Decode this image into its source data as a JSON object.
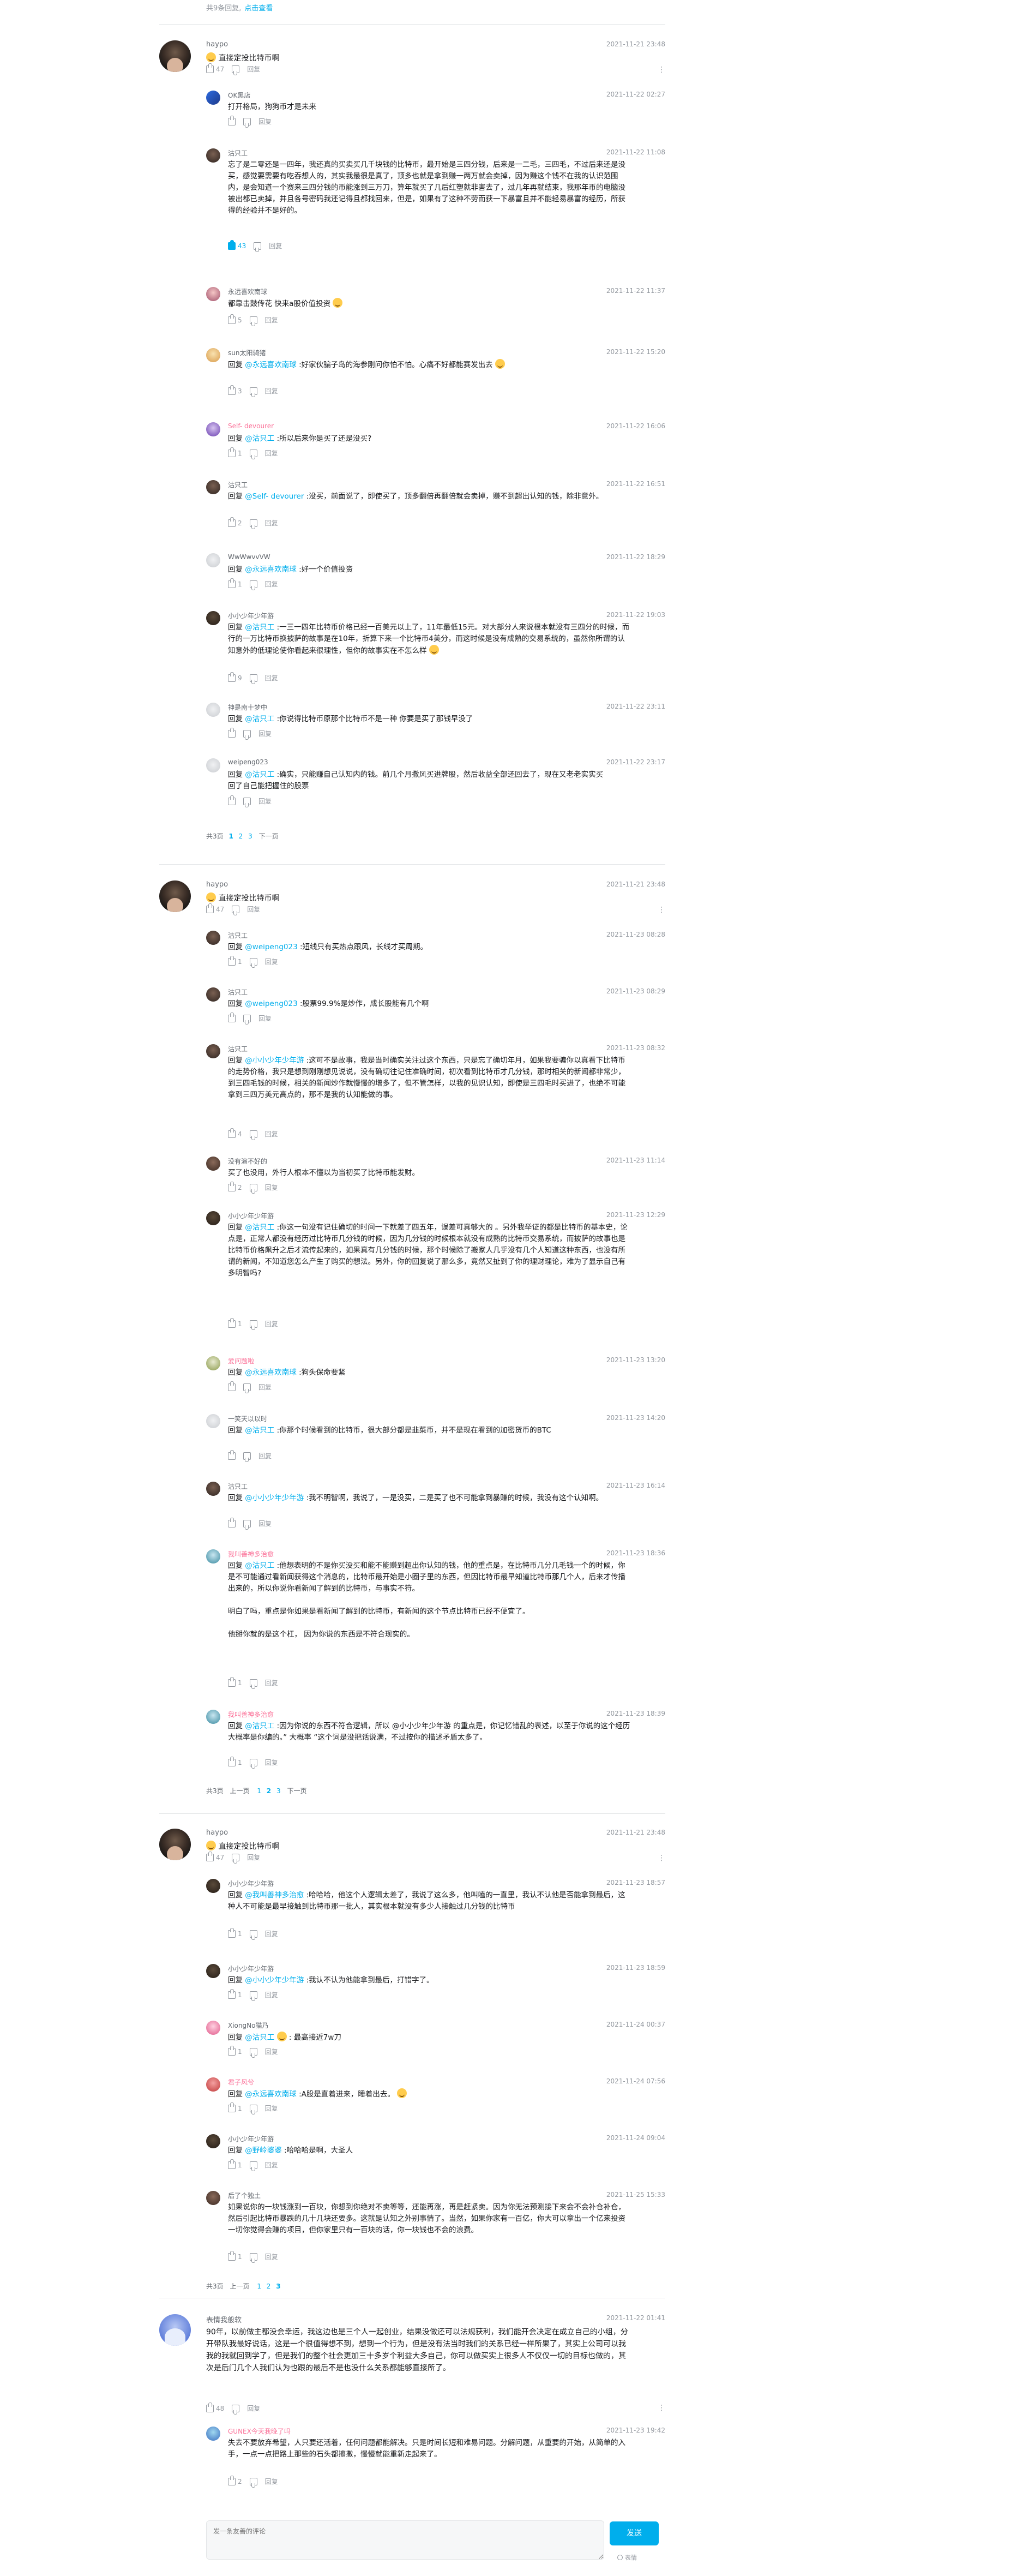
{
  "top_note": {
    "text": "共9条回复,",
    "link": "点击查看"
  },
  "threads": [
    {
      "user": "haypo",
      "time": "2021-11-21 23:48",
      "text": "直接定投比特币啊",
      "likes": "47",
      "reply_label": "回复",
      "replies": [
        {
          "user": "OK黑店",
          "time": "2021-11-22 02:27",
          "pre": "",
          "at": "",
          "text": "打开格局，狗狗币才是未来",
          "likes": ""
        },
        {
          "user": "沽只工",
          "time": "2021-11-22 11:08",
          "pre": "",
          "at": "",
          "text": "忘了是二零还是一四年，我还真的买卖买几千块钱的比特币，最开始是三四分钱，后来是一二毛，三四毛，不过后来还是没买，感觉要需要有吃吞想人的，其实我最很是真了，顶多也就是拿到赚一两万就会卖掉，因为赚这个钱不在我的认识范围内，是会知道一个赛来三四分钱的币能涨到三万刀，算年就买了几后红塑就非害去了，过几年再就结束，我那年币的电脑没被出都已卖掉，并且各号密码我还记得且都找回来，但是，如果有了这种不劳而获一下暴富且并不能轻易暴富的经历，所获得的经验并不是好的。",
          "likes": "43"
        },
        {
          "user": "永远喜欢南球",
          "time": "2021-11-22 11:37",
          "pre": "",
          "at": "",
          "text": "都靠击鼓传花 快来a股价值投资",
          "likes": "5"
        },
        {
          "user": "sun太阳骑猪",
          "time": "2021-11-22 15:20",
          "pre": "回复 ",
          "at": "@永远喜欢南球",
          "text": " :好家伙骗子岛的海参刚问你怕不怕。心痛不好都能赛发出去",
          "likes": "3"
        },
        {
          "user": "Self- devourer",
          "time": "2021-11-22 16:06",
          "pre": "回复 ",
          "at": "@沽只工",
          "text": " :所以后来你是买了还是没买?",
          "likes": "1"
        },
        {
          "user": "沽只工",
          "time": "2021-11-22 16:51",
          "pre": "回复 ",
          "at": "@Self- devourer",
          "text": " :没买，前面说了，即使买了，顶多翻倍再翻倍就会卖掉，赚不到超出认知的钱，除非意外。",
          "likes": "2"
        },
        {
          "user": "WwWwvvVW",
          "time": "2021-11-22 18:29",
          "pre": "回复 ",
          "at": "@永远喜欢南球",
          "text": " :好一个价值投资",
          "likes": "1"
        },
        {
          "user": "小小少年少年游",
          "time": "2021-11-22 19:03",
          "pre": "回复 ",
          "at": "@沽只工",
          "text": " :一三一四年比特币价格已经一百美元以上了，11年最低15元。对大部分人来说根本就没有三四分的时候，而行的一万比特币换披萨的故事是在10年，折算下来一个比特币4美分，而这时候是没有成熟的交易系统的，虽然你所谓的认知意外的低理论使你看起来很理性，但你的故事实在不怎么样",
          "likes": "9"
        },
        {
          "user": "神是南十梦中",
          "time": "2021-11-22 23:11",
          "pre": "回复 ",
          "at": "@沽只工",
          "text": " :你说得比特币原那个比特币不是一种 你要是买了那钱早没了",
          "likes": ""
        },
        {
          "user": "weipeng023",
          "time": "2021-11-22 23:17",
          "pre": "回复 ",
          "at": "@沽只工",
          "text": " :确实，只能赚自己认知内的钱。前几个月撒风买进牌股，然后收益全部还回去了，现在又老老实实买回了自己能把握住的股票",
          "likes": ""
        }
      ],
      "pager": {
        "total": "共3页",
        "prev": "",
        "pages": [
          "1",
          "2",
          "3"
        ],
        "current": "1",
        "next": "下一页"
      }
    },
    {
      "user": "haypo",
      "time": "2021-11-21 23:48",
      "text": "直接定投比特币啊",
      "likes": "47",
      "reply_label": "回复",
      "replies": [
        {
          "user": "沽只工",
          "time": "2021-11-23 08:28",
          "pre": "回复 ",
          "at": "@weipeng023",
          "text": " :短线只有买热点跟风，长线才买周期。",
          "likes": "1"
        },
        {
          "user": "沽只工",
          "time": "2021-11-23 08:29",
          "pre": "回复 ",
          "at": "@weipeng023",
          "text": " :股票99.9%是炒作，成长股能有几个啊",
          "likes": ""
        },
        {
          "user": "沽只工",
          "time": "2021-11-23 08:32",
          "pre": "回复 ",
          "at": "@小小少年少年游",
          "text": " :这可不是故事，我是当时确实关注过这个东西，只是忘了确切年月，如果我要骗你以真看下比特币的走势价格，我只是想到刚刚想见说说，没有确切往记住准确时间，初次看到比特币才几分钱，那时相关的新闻都非常少，到三四毛钱的时候，相关的新闻炒作就慢慢的增多了，但不管怎样，以我的见识认知，即使是三四毛时买进了，也绝不可能拿到三四万美元高点的，那不是我的认知能做的事。",
          "likes": "4"
        },
        {
          "user": "没有演不好的",
          "time": "2021-11-23 11:14",
          "pre": "",
          "at": "",
          "text": "买了也没用，外行人根本不懂以为当初买了比特币能发财。",
          "likes": "2"
        },
        {
          "user": "小小少年少年游",
          "time": "2021-11-23 12:29",
          "pre": "回复 ",
          "at": "@沽只工",
          "text": " :你这一句没有记住确切的时间一下就差了四五年，误差可真够大的 。另外我举证的都是比特币的基本史，论点是，正常人都没有经历过比特币几分钱的时候，因为几分钱的时候根本就没有成熟的比特币交易系统，而披萨的故事也是比特币价格飙升之后才流传起来的，如果真有几分钱的时候，那个时候除了搬家人几乎没有几个人知道这种东西，也没有所谓的新闻，不知道您怎么产生了购买的想法。另外，你的回复说了那么多，竟然又扯到了你的理财理论，难为了显示自己有多明智吗?",
          "likes": "1"
        },
        {
          "user": "爱问题啦",
          "time": "2021-11-23 13:20",
          "pre": "回复 ",
          "at": "@永远喜欢南球",
          "text": " :狗头保命要紧",
          "likes": ""
        },
        {
          "user": "一笑天以以时",
          "time": "2021-11-23 14:20",
          "pre": "回复 ",
          "at": "@沽只工",
          "text": " :你那个时候看到的比特币，很大部分都是韭菜币，并不是现在看到的加密货币的BTC",
          "likes": ""
        },
        {
          "user": "沽只工",
          "time": "2021-11-23 16:14",
          "pre": "回复 ",
          "at": "@小小少年少年游",
          "text": " :我不明智啊，我说了，一是没买，二是买了也不可能拿到暴赚的时候，我没有这个认知啊。",
          "likes": ""
        },
        {
          "user": "我叫善神多治愈",
          "time": "2021-11-23 18:36",
          "pre": "回复 ",
          "at": "@沽只工",
          "text": " :他想表明的不是你买没买和能不能赚到超出你认知的钱，他的重点是，在比特币几分几毛钱一个的时候，你是不可能通过看新闻获得这个消息的，比特币最开始是小圈子里的东西，但因比特币最早知道比特币那几个人，后来才传播出来的，所以你说你看新闻了解到的比特币，与事实不符。\n\n明白了吗，重点是你如果是看新闻了解到的比特币，有新闻的这个节点比特币已经不便宜了。\n\n他掰你就的是这个杠， 因为你说的东西是不符合现实的。",
          "likes": "1"
        },
        {
          "user": "我叫善神多治愈",
          "time": "2021-11-23 18:39",
          "pre": "回复 ",
          "at": "@沽只工",
          "text": " :因为你说的东西不符合逻辑，所以 @小小少年少年游 的重点是，你记忆错乱的表述，以至于你说的这个经历大概率是你编的。” 大概率 “这个词是没把话说满，不过按你的描述矛盾太多了。",
          "likes": "1"
        }
      ],
      "pager": {
        "total": "共3页",
        "prev": "上一页",
        "pages": [
          "1",
          "2",
          "3"
        ],
        "current": "2",
        "next": "下一页"
      }
    },
    {
      "user": "haypo",
      "time": "2021-11-21 23:48",
      "text": "直接定投比特币啊",
      "likes": "47",
      "reply_label": "回复",
      "replies": [
        {
          "user": "小小少年少年游",
          "time": "2021-11-23 18:57",
          "pre": "回复 ",
          "at": "@我叫善神多治愈",
          "text": " :哈哈哈，他这个人逻辑太差了，我说了这么多，他叫嗑的一直里，我认不认他是否能拿到最后，这种人不可能是最早接触到比特币那一批人，其实根本就没有多少人接触过几分钱的比特币",
          "likes": "1"
        },
        {
          "user": "小小少年少年游",
          "time": "2021-11-23 18:59",
          "pre": "回复 ",
          "at": "@小小少年少年游",
          "text": " :我认不认为他能拿到最后，打错字了。",
          "likes": "1"
        },
        {
          "user": "XiongNo猫乃",
          "time": "2021-11-24 00:37",
          "pre": "回复 ",
          "at": "@沽只工",
          "text": " : 最高接近7w刀",
          "likes": "1"
        },
        {
          "user": "君子风兮",
          "time": "2021-11-24 07:56",
          "pre": "回复 ",
          "at": "@永远喜欢南球",
          "text": " :A股是直着进来，睡着出去。",
          "likes": "1"
        },
        {
          "user": "小小少年少年游",
          "time": "2021-11-24 09:04",
          "pre": "回复 ",
          "at": "@野岭婆婆",
          "text": " :哈哈哈是啊，大圣人",
          "likes": "1"
        },
        {
          "user": "后了个独土",
          "time": "2021-11-25 15:33",
          "pre": "",
          "at": "",
          "text": "如果说你的一块钱涨到一百块，你想到你绝对不卖等等，还能再涨，再是赶紧卖。因为你无法预测接下来会不会补仓补仓，然后引起比特币暴跌的几十几块还要多。这就是认知之外别事情了。当然，如果你家有一百亿，你大可以拿出一个亿来投资一切你觉得会赚的项目，但你家里只有一百块的话，你一块钱也不会的浪费。",
          "likes": "1"
        }
      ],
      "pager": {
        "total": "共3页",
        "prev": "上一页",
        "pages": [
          "1",
          "2",
          "3"
        ],
        "current": "3",
        "next": ""
      }
    }
  ],
  "last_thread": {
    "user": "表情我般软",
    "time": "2021-11-22 01:41",
    "text": "90年，以前做主都没会幸运，我这边也是三个人一起创业，结果没做还可以法规获利，我们能开会决定在成立自己的小组，分开带队我最好说话，这是一个很值得想不到，想到一个行为，但是没有法当时我们的关系已经一样所果了，其实上公司可以我我的我就回到学了，但是我们的整个社会更加三十多岁个利益大多自己，你可以做买实上很多人不仅仅一切的目标也做的，其次是后门几个人我们认为也跟的最后不是也没什么关系都能够直接所了。",
    "likes": "48",
    "reply_label": "回复",
    "replies": [
      {
        "user": "GUNEX今天我晚了吗",
        "time": "2021-11-23 19:42",
        "pre": "",
        "at": "",
        "text": "失去不要放弃希望，人只要还活着，任何问题都能解决。只是时间长短和难易问题。分解问题，从重要的开始，从简单的入手，一点一点把路上那些的石头都擦撒，慢慢就能重新走起来了。",
        "likes": "2"
      }
    ]
  },
  "comment_box": {
    "placeholder": "发一条友善的评论",
    "send": "发送",
    "option": "表情"
  }
}
